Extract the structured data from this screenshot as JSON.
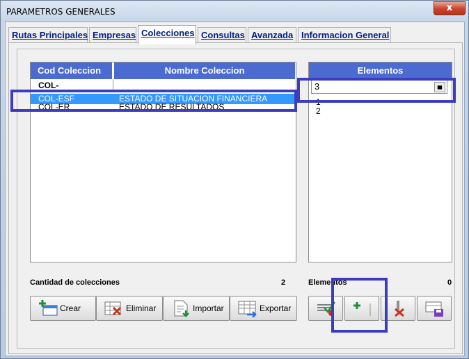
{
  "window": {
    "title": "PARAMETROS GENERALES",
    "close_label": "x"
  },
  "tabs": [
    {
      "label": "Rutas Principales"
    },
    {
      "label": "Empresas"
    },
    {
      "label": "Colecciones"
    },
    {
      "label": "Consultas"
    },
    {
      "label": "Avanzada"
    },
    {
      "label": "Informacion General"
    }
  ],
  "collections": {
    "headers": {
      "code": "Cod Coleccion",
      "name": "Nombre Coleccion"
    },
    "new_row": {
      "code": "COL-",
      "name": ""
    },
    "rows": [
      {
        "code": "COL-ESF",
        "name": "ESTADO DE SITUACION FINANCIERA",
        "selected": true
      },
      {
        "code": "COL-ER",
        "name": "ESTADO DE RESULTADOS",
        "selected": false
      }
    ],
    "count_label": "Cantidad de colecciones",
    "count_value": "2"
  },
  "elements": {
    "header": "Elementos",
    "input_value": "3",
    "items": [
      "1",
      "2"
    ],
    "count_label": "Elementos",
    "count_value": "0"
  },
  "buttons": {
    "create": "Crear",
    "delete": "Eliminar",
    "import": "Importar",
    "export": "Exportar"
  },
  "colors": {
    "header_bg": "#4c6bd1",
    "selection": "#3399ff",
    "highlight": "#3b3cbf"
  }
}
